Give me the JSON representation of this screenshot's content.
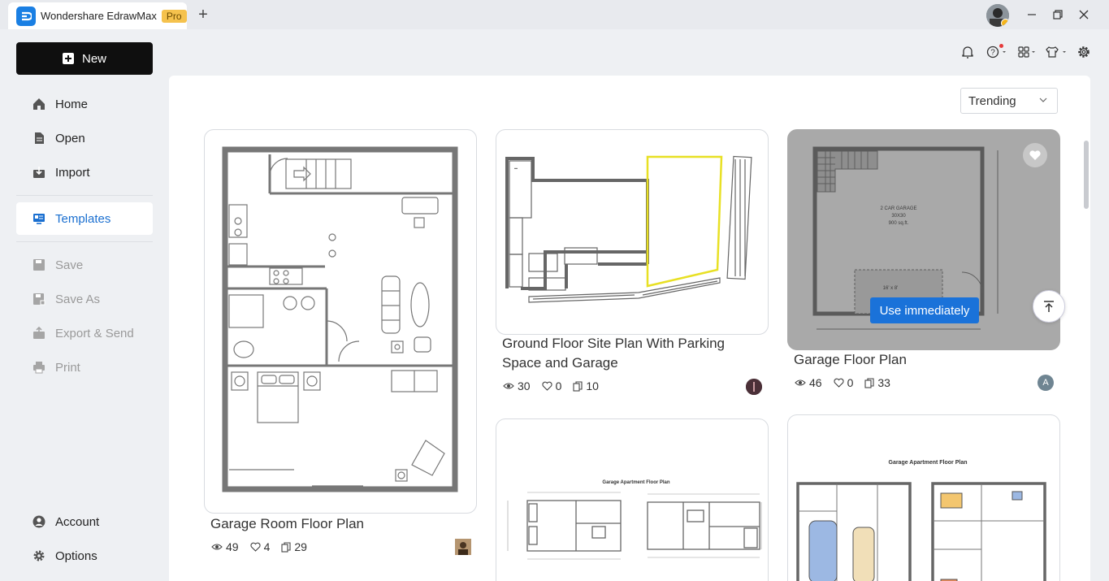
{
  "app": {
    "name": "Wondershare EdrawMax",
    "badge": "Pro"
  },
  "sidebar": {
    "new_label": "New",
    "items": [
      {
        "label": "Home",
        "icon": "home-icon"
      },
      {
        "label": "Open",
        "icon": "document-icon"
      },
      {
        "label": "Import",
        "icon": "import-icon"
      },
      {
        "label": "Templates",
        "icon": "templates-icon"
      },
      {
        "label": "Save",
        "icon": "save-icon"
      },
      {
        "label": "Save As",
        "icon": "save-as-icon"
      },
      {
        "label": "Export & Send",
        "icon": "export-icon"
      },
      {
        "label": "Print",
        "icon": "print-icon"
      },
      {
        "label": "Account",
        "icon": "account-icon"
      },
      {
        "label": "Options",
        "icon": "gear-icon"
      }
    ]
  },
  "main": {
    "sort_value": "Trending",
    "use_label": "Use immediately",
    "cards": [
      {
        "title": "Garage Room Floor Plan",
        "views": "49",
        "likes": "4",
        "copies": "29"
      },
      {
        "title": "Ground Floor Site Plan With Parking Space and Garage",
        "views": "30",
        "likes": "0",
        "copies": "10"
      },
      {
        "title": "Garage Floor Plan",
        "views": "46",
        "likes": "0",
        "copies": "33",
        "avatar_letter": "A"
      },
      {
        "thumb_title": "Garage Apartment Floor Plan"
      },
      {
        "thumb_title": "Garage Apartment Floor Plan"
      }
    ],
    "thumb_text": {
      "garage_label": "2 CAR GARAGE",
      "garage_dims": "30X30",
      "garage_area": "900 sq.ft.",
      "garage_door": "16' x 8'"
    }
  },
  "colors": {
    "accent": "#1a72d9",
    "pro_badge": "#f5c24d"
  }
}
